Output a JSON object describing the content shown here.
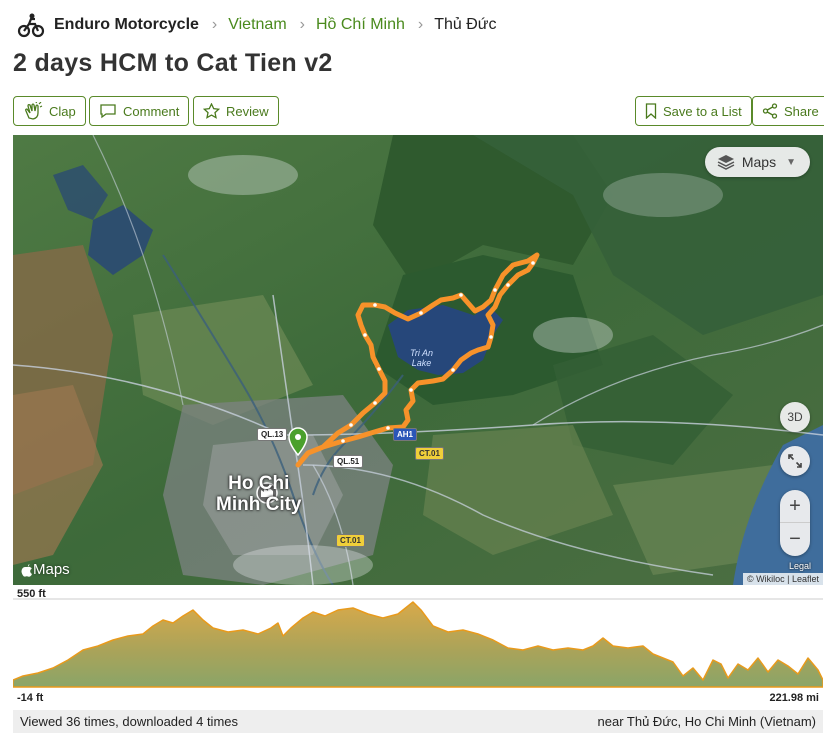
{
  "breadcrumb": {
    "logo_icon": "enduro-motorcycle-icon",
    "root": "Enduro Motorcycle",
    "items": [
      "Vietnam",
      "Hồ Chí Minh"
    ],
    "current": "Thủ Đức"
  },
  "title": "2 days HCM to Cat Tien v2",
  "actions": {
    "clap": "Clap",
    "comment": "Comment",
    "review": "Review",
    "save": "Save to a List",
    "share": "Share"
  },
  "map": {
    "type_selector": "Maps",
    "btn_3d": "3D",
    "zoom_in": "+",
    "zoom_out": "−",
    "brand": "Maps",
    "legal": "Legal",
    "attribution": "© Wikiloc | Leaflet",
    "city": "Ho Chi Minh City",
    "city_line1": "Ho Chi",
    "city_line2": "Minh City",
    "lake_line1": "Tri An",
    "lake_line2": "Lake",
    "roads": [
      "QL.13",
      "QL.51",
      "AH1",
      "CT.01",
      "CT.01"
    ],
    "route_color": "#f7922a"
  },
  "elevation": {
    "max_label": "550 ft",
    "min_label": "-14 ft",
    "distance_label": "221.98 mi"
  },
  "footer": {
    "stats": "Viewed 36 times, downloaded 4 times",
    "location": "near Thủ Đức, Ho Chi Minh (Vietnam)"
  }
}
